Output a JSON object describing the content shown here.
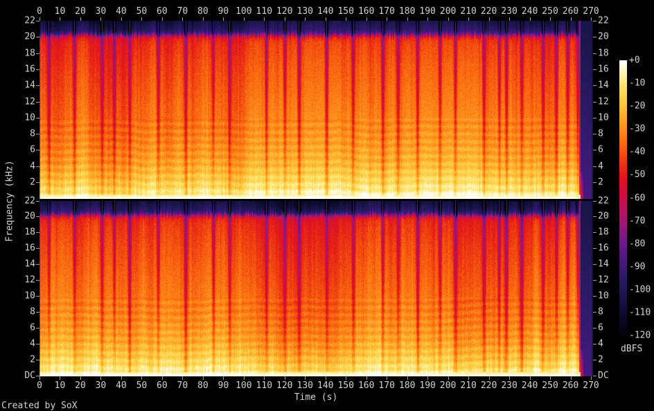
{
  "figure": {
    "credit": "Created by SoX",
    "background": "#000000",
    "text_color": "#d2d2d2",
    "tick_color": "#9c9c9c"
  },
  "chart_data": {
    "type": "heatmap",
    "subtype": "audio-spectrogram",
    "tool": "SoX",
    "title": "",
    "xlabel": "Time (s)",
    "ylabel": "Frequency (kHz)",
    "channels": 2,
    "x_tick_labels": [
      "0",
      "10",
      "20",
      "30",
      "40",
      "50",
      "60",
      "70",
      "80",
      "90",
      "100",
      "110",
      "120",
      "130",
      "140",
      "150",
      "160",
      "170",
      "180",
      "190",
      "200",
      "210",
      "220",
      "230",
      "240",
      "250",
      "260",
      "270"
    ],
    "x_range_s": [
      0,
      271
    ],
    "y_tick_labels_channel1": [
      "22",
      "20",
      "18",
      "16",
      "14",
      "12",
      "10",
      "8",
      "6",
      "4",
      "2"
    ],
    "y_tick_labels_channel2": [
      "22",
      "20",
      "18",
      "16",
      "14",
      "12",
      "10",
      "8",
      "6",
      "4",
      "2",
      "DC"
    ],
    "y_range_khz": [
      0,
      22
    ],
    "grid": false,
    "legend_position": "right-colorbar",
    "colorbar": {
      "unit_label": "dBFS",
      "tick_labels": [
        "+0",
        "-10",
        "-20",
        "-30",
        "-40",
        "-50",
        "-60",
        "-70",
        "-80",
        "-90",
        "-100",
        "-110",
        "-120"
      ],
      "range_db": [
        0,
        -120
      ],
      "stops": [
        [
          0,
          "#ffffff"
        ],
        [
          -4,
          "#fff7c9"
        ],
        [
          -10,
          "#ffe878"
        ],
        [
          -16,
          "#ffd34b"
        ],
        [
          -22,
          "#ffb732"
        ],
        [
          -30,
          "#ff8c1a"
        ],
        [
          -38,
          "#f8600e"
        ],
        [
          -46,
          "#ea2f12"
        ],
        [
          -52,
          "#e0131c"
        ],
        [
          -58,
          "#d00e3e"
        ],
        [
          -64,
          "#bc1158"
        ],
        [
          -72,
          "#9a1878"
        ],
        [
          -80,
          "#6e178f"
        ],
        [
          -88,
          "#46197f"
        ],
        [
          -96,
          "#2a1a66"
        ],
        [
          -104,
          "#191448"
        ],
        [
          -112,
          "#0b0929"
        ],
        [
          -120,
          "#040310"
        ]
      ]
    },
    "audio_end_s": 264.6,
    "lowpass_cutoff_khz": 20.1,
    "spectral_profile_db_by_freq_fraction": [
      [
        0.0,
        -4
      ],
      [
        0.01,
        -6
      ],
      [
        0.04,
        -12
      ],
      [
        0.1,
        -18
      ],
      [
        0.2,
        -26
      ],
      [
        0.35,
        -32
      ],
      [
        0.55,
        -37
      ],
      [
        0.75,
        -42
      ],
      [
        0.87,
        -46
      ],
      [
        0.9,
        -49
      ],
      [
        0.915,
        -62
      ],
      [
        0.93,
        -88
      ],
      [
        0.95,
        -98
      ],
      [
        1.0,
        -107
      ]
    ],
    "silence_gap_times_s": [
      4.5,
      17,
      30.5,
      36.5,
      44,
      58,
      71.5,
      85,
      93,
      111,
      120,
      127,
      140.5,
      153.5,
      168,
      175.5,
      185,
      196,
      203.5,
      217.5,
      225,
      228.5,
      236,
      246.5,
      253,
      258.5,
      263.5
    ],
    "channel_seeds": [
      101,
      202
    ]
  }
}
